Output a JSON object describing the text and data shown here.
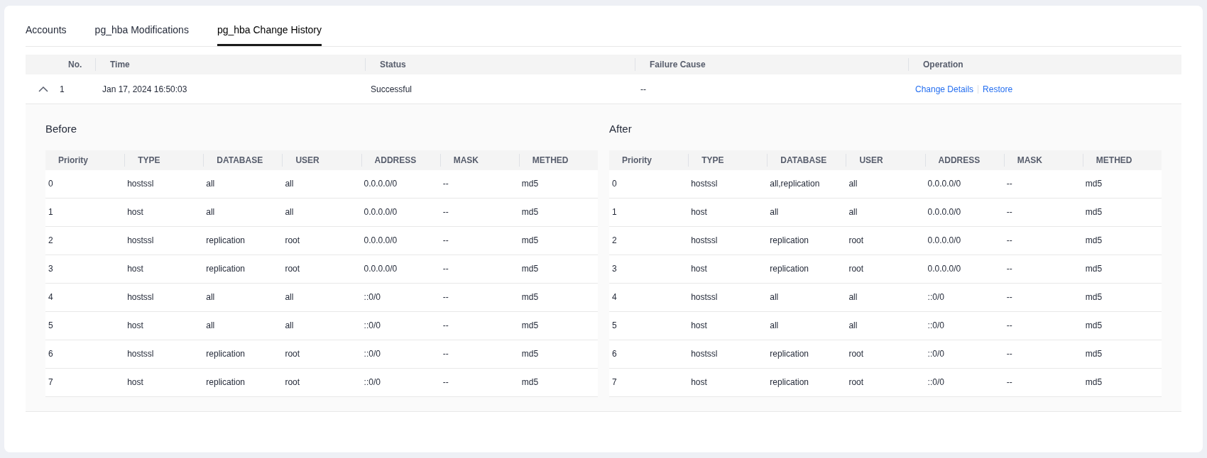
{
  "tabs": [
    {
      "label": "Accounts",
      "selected": false
    },
    {
      "label": "pg_hba Modifications",
      "selected": false
    },
    {
      "label": "pg_hba Change History",
      "selected": true
    }
  ],
  "history": {
    "columns": [
      "No.",
      "Time",
      "Status",
      "Failure Cause",
      "Operation"
    ],
    "rows": [
      {
        "expanded": true,
        "no": "1",
        "time": "Jan 17, 2024 16:50:03",
        "status": "Successful",
        "failure_cause": "--",
        "actions": [
          "Change Details",
          "Restore"
        ],
        "details": [
          {
            "title": "Before",
            "columns": [
              "Priority",
              "TYPE",
              "DATABASE",
              "USER",
              "ADDRESS",
              "MASK",
              "METHED"
            ],
            "rows": [
              [
                "0",
                "hostssl",
                "all",
                "all",
                "0.0.0.0/0",
                "--",
                "md5"
              ],
              [
                "1",
                "host",
                "all",
                "all",
                "0.0.0.0/0",
                "--",
                "md5"
              ],
              [
                "2",
                "hostssl",
                "replication",
                "root",
                "0.0.0.0/0",
                "--",
                "md5"
              ],
              [
                "3",
                "host",
                "replication",
                "root",
                "0.0.0.0/0",
                "--",
                "md5"
              ],
              [
                "4",
                "hostssl",
                "all",
                "all",
                "::0/0",
                "--",
                "md5"
              ],
              [
                "5",
                "host",
                "all",
                "all",
                "::0/0",
                "--",
                "md5"
              ],
              [
                "6",
                "hostssl",
                "replication",
                "root",
                "::0/0",
                "--",
                "md5"
              ],
              [
                "7",
                "host",
                "replication",
                "root",
                "::0/0",
                "--",
                "md5"
              ]
            ]
          },
          {
            "title": "After",
            "columns": [
              "Priority",
              "TYPE",
              "DATABASE",
              "USER",
              "ADDRESS",
              "MASK",
              "METHED"
            ],
            "rows": [
              [
                "0",
                "hostssl",
                "all,replication",
                "all",
                "0.0.0.0/0",
                "--",
                "md5"
              ],
              [
                "1",
                "host",
                "all",
                "all",
                "0.0.0.0/0",
                "--",
                "md5"
              ],
              [
                "2",
                "hostssl",
                "replication",
                "root",
                "0.0.0.0/0",
                "--",
                "md5"
              ],
              [
                "3",
                "host",
                "replication",
                "root",
                "0.0.0.0/0",
                "--",
                "md5"
              ],
              [
                "4",
                "hostssl",
                "all",
                "all",
                "::0/0",
                "--",
                "md5"
              ],
              [
                "5",
                "host",
                "all",
                "all",
                "::0/0",
                "--",
                "md5"
              ],
              [
                "6",
                "hostssl",
                "replication",
                "root",
                "::0/0",
                "--",
                "md5"
              ],
              [
                "7",
                "host",
                "replication",
                "root",
                "::0/0",
                "--",
                "md5"
              ]
            ]
          }
        ]
      }
    ]
  }
}
